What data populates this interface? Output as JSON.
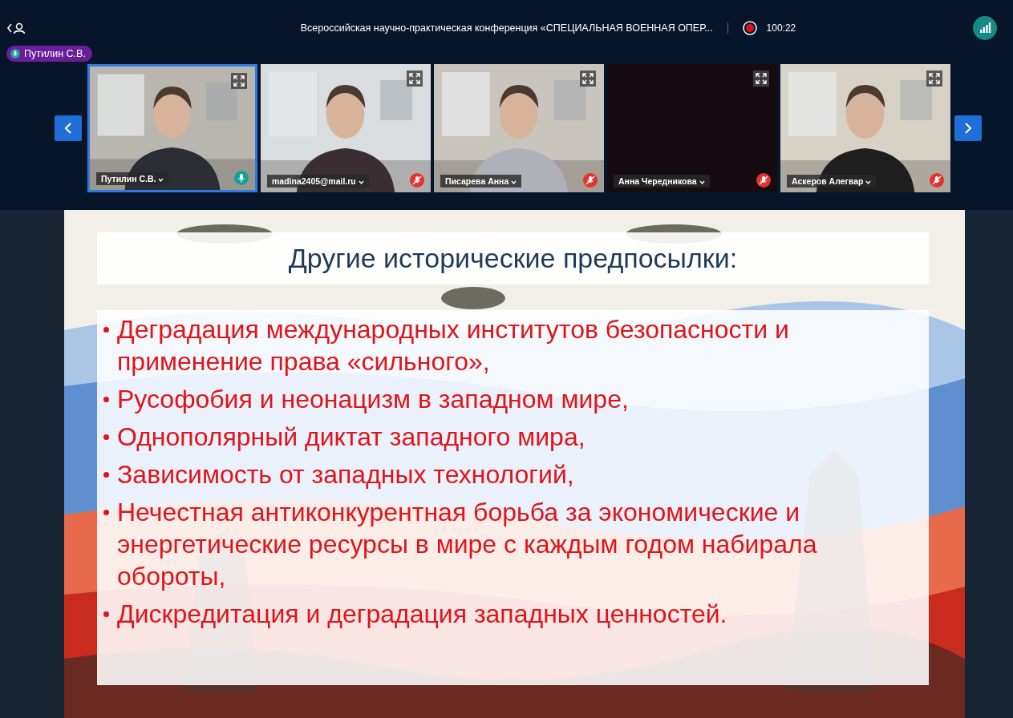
{
  "header": {
    "title": "Всероссийская научно-практическая конференция «СПЕЦИАЛЬНАЯ ВОЕННАЯ ОПЕР...",
    "recording": true,
    "timer": "100:22",
    "speaker": "Путилин С.В."
  },
  "participants": [
    {
      "name": "Путилин С.В.",
      "muted": false,
      "selected": true,
      "camera_on": true
    },
    {
      "name": "madina2405@mail.ru",
      "muted": true,
      "selected": false,
      "camera_on": true
    },
    {
      "name": "Писарева Анна",
      "muted": true,
      "selected": false,
      "camera_on": true
    },
    {
      "name": "Анна Чередникова",
      "muted": true,
      "selected": false,
      "camera_on": false
    },
    {
      "name": "Аскеров Алегвар",
      "muted": true,
      "selected": false,
      "camera_on": true
    }
  ],
  "slide": {
    "title": "Другие исторические предпосылки:",
    "bullets": [
      "Деградация международных институтов безопасности и применение права «сильного»,",
      "Русофобия и неонацизм в западном мире,",
      "Однополярный диктат западного мира,",
      "Зависимость от западных технологий,",
      "Нечестная антиконкурентная борьба за экономические и энергетические ресурсы в мире с каждым годом набирала обороты,",
      "Дискредитация и деградация западных ценностей."
    ]
  }
}
